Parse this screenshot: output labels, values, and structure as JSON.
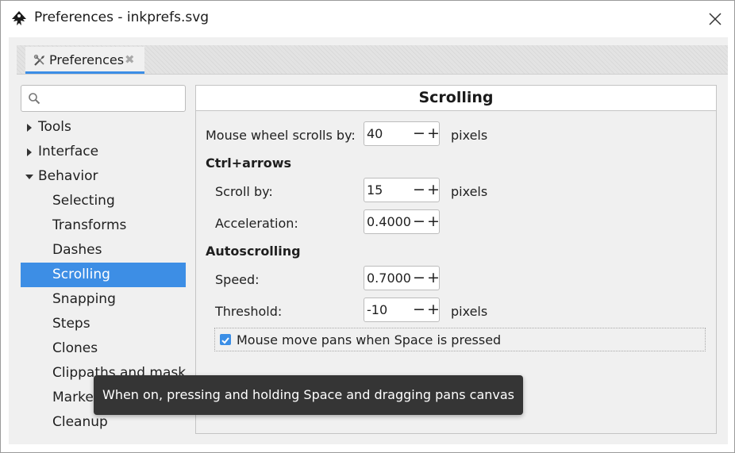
{
  "window": {
    "title": "Preferences - inkprefs.svg",
    "app_icon": "inkscape-icon",
    "close_icon": "close-icon"
  },
  "tab": {
    "label": "Preferences",
    "icon": "tools-icon",
    "close_glyph": "✖"
  },
  "search": {
    "value": "",
    "placeholder": "",
    "icon": "search-icon"
  },
  "sidebar": {
    "items": [
      {
        "label": "Tools",
        "level": 0,
        "expander": "collapsed"
      },
      {
        "label": "Interface",
        "level": 0,
        "expander": "collapsed"
      },
      {
        "label": "Behavior",
        "level": 0,
        "expander": "expanded"
      },
      {
        "label": "Selecting",
        "level": 1
      },
      {
        "label": "Transforms",
        "level": 1
      },
      {
        "label": "Dashes",
        "level": 1
      },
      {
        "label": "Scrolling",
        "level": 1,
        "selected": true
      },
      {
        "label": "Snapping",
        "level": 1
      },
      {
        "label": "Steps",
        "level": 1
      },
      {
        "label": "Clones",
        "level": 1
      },
      {
        "label": "Clippaths and masks",
        "level": 1
      },
      {
        "label": "Markers",
        "level": 1
      },
      {
        "label": "Cleanup",
        "level": 1
      }
    ]
  },
  "panel": {
    "title": "Scrolling",
    "mouse_wheel": {
      "label": "Mouse wheel scrolls by:",
      "value": "40",
      "unit": "pixels"
    },
    "ctrl_arrows": {
      "heading": "Ctrl+arrows",
      "scroll_by": {
        "label": "Scroll by:",
        "value": "15",
        "unit": "pixels"
      },
      "acceleration": {
        "label": "Acceleration:",
        "value": "0.4000"
      }
    },
    "autoscrolling": {
      "heading": "Autoscrolling",
      "speed": {
        "label": "Speed:",
        "value": "0.7000"
      },
      "threshold": {
        "label": "Threshold:",
        "value": "-10",
        "unit": "pixels"
      }
    },
    "space_pan": {
      "label": "Mouse move pans when Space is pressed",
      "checked": true
    },
    "spin_minus": "−",
    "spin_plus": "+"
  },
  "tooltip": {
    "text": "When on, pressing and holding Space and dragging pans canvas"
  },
  "colors": {
    "accent": "#3d8ee5",
    "tooltip_bg": "#353535",
    "panel_bg": "#f0f0f0"
  }
}
